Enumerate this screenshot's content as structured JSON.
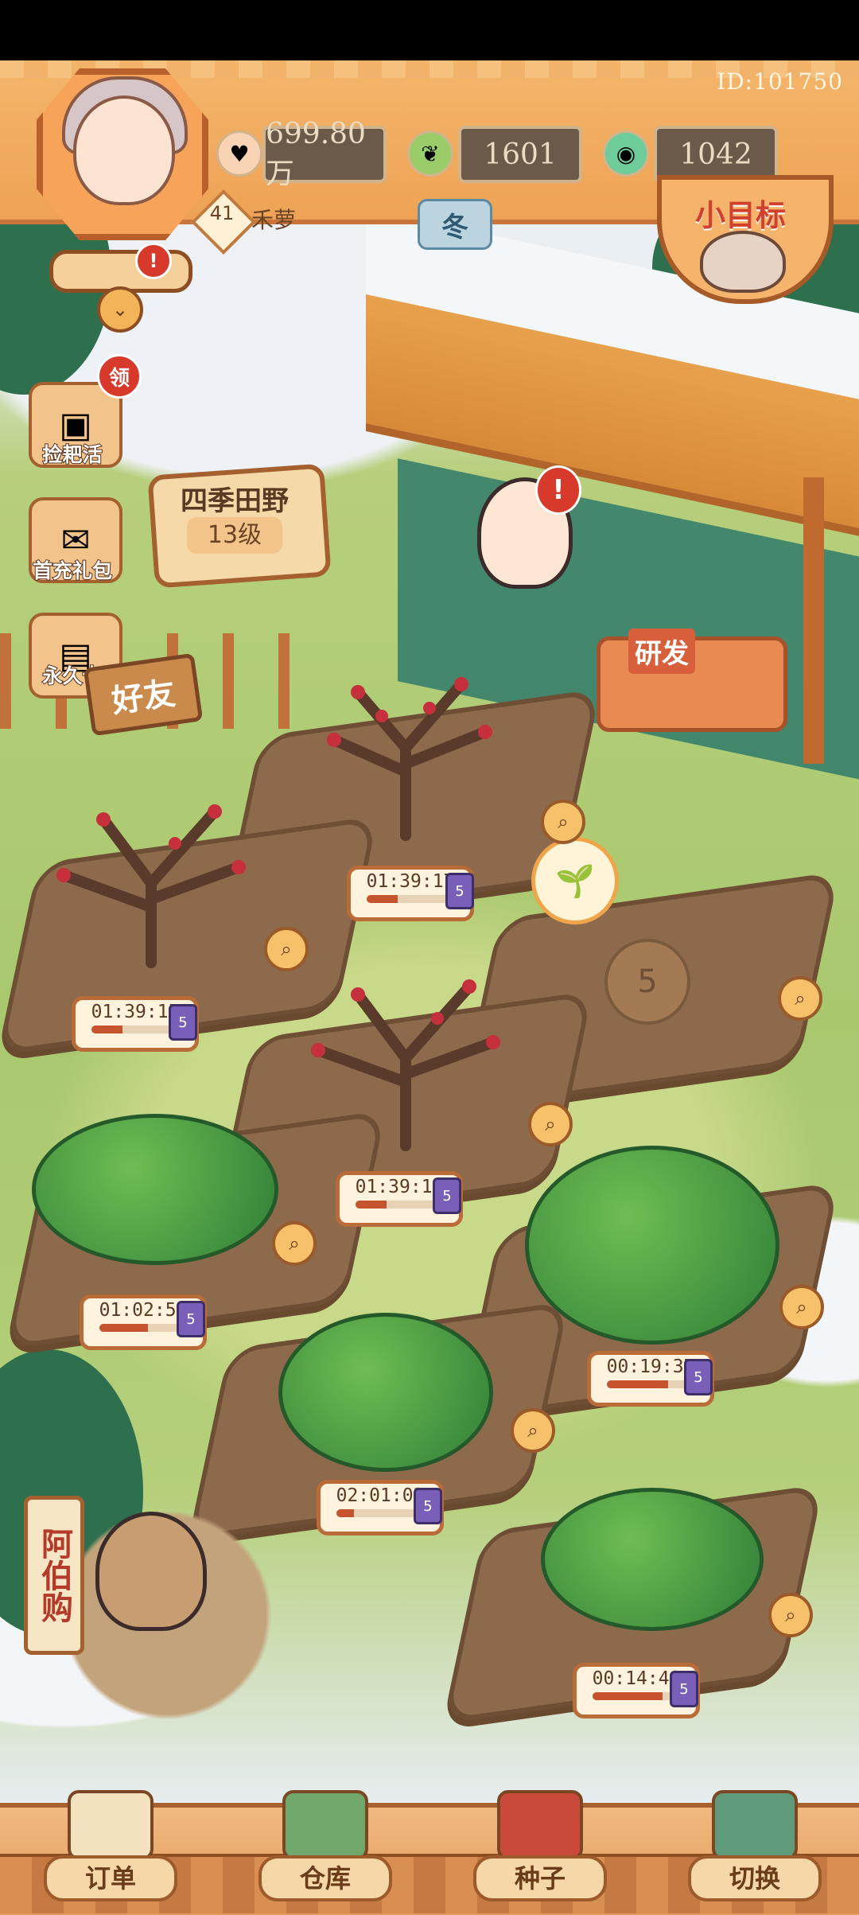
{
  "header": {
    "user_id": "ID:101750",
    "player_name": "禾萝",
    "level": "41",
    "season": "冬",
    "goal_label": "小目标",
    "resources": [
      {
        "name": "coins",
        "icon": "coin-icon",
        "value": "699.80万"
      },
      {
        "name": "leaves",
        "icon": "leaf-icon",
        "value": "1601"
      },
      {
        "name": "gems",
        "icon": "gem-icon",
        "value": "1042"
      }
    ]
  },
  "side_menu": {
    "claim_badge": "领",
    "items": [
      {
        "label": "捡耙活",
        "icon": "treasure-chest-icon"
      },
      {
        "label": "首充礼包",
        "icon": "gift-pack-icon"
      },
      {
        "label": "永久卡",
        "icon": "card-icon"
      }
    ]
  },
  "field": {
    "name": "四季田野",
    "level": "13级",
    "friends_label": "好友",
    "research_label": "研发",
    "empty_plot_number": "5"
  },
  "plots": [
    {
      "timer": "01:39:17",
      "progress": 0.35,
      "plant": "plum-tree"
    },
    {
      "timer": "01:39:15",
      "progress": 0.35,
      "plant": "plum-tree"
    },
    {
      "timer": "01:39:19",
      "progress": 0.35,
      "plant": "plum-tree"
    },
    {
      "timer": "01:02:50",
      "progress": 0.55,
      "plant": "flower-vine"
    },
    {
      "timer": "00:19:37",
      "progress": 0.7,
      "plant": "tea-bush"
    },
    {
      "timer": "02:01:02",
      "progress": 0.2,
      "plant": "flower-bush"
    },
    {
      "timer": "00:14:46",
      "progress": 0.8,
      "plant": "corn"
    }
  ],
  "timer_tag": "5",
  "shop": {
    "sign": "阿伯购"
  },
  "bottom_nav": [
    {
      "label": "订单",
      "icon": "clipboard-icon"
    },
    {
      "label": "仓库",
      "icon": "warehouse-icon"
    },
    {
      "label": "种子",
      "icon": "seed-book-icon"
    },
    {
      "label": "切换",
      "icon": "map-pin-icon"
    }
  ],
  "colors": {
    "header": "#eea255",
    "accent_red": "#d73a2a",
    "soil": "#8d6a4c",
    "timer_fill": "#c4532e"
  }
}
